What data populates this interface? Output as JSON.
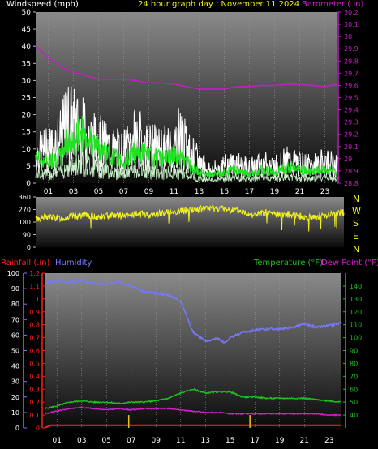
{
  "header": {
    "left_label": "Windspeed (mph)",
    "center_label": "24 hour graph day : November 11 2024",
    "right_label": "Barometer (.in)"
  },
  "colors": {
    "background": "#000000",
    "plot_top": "#8a8a8a",
    "plot_bottom": "#0a0a0a",
    "wind_gust": "#ffffff",
    "wind_avg": "#22e022",
    "wind_min": "#c8f0c8",
    "barometer": "#c020c0",
    "direction": "#f0f020",
    "rainfall": "#ff2020",
    "humidity": "#7878ff",
    "temperature": "#20c020",
    "dewpoint": "#d020d0",
    "hours": "#ffffff",
    "left_axis_text": "#ffffff",
    "direction_letters": "#f0f020",
    "rain_bar": "#f0c020"
  },
  "time_axis_labels": [
    "01",
    "03",
    "05",
    "07",
    "09",
    "11",
    "13",
    "15",
    "17",
    "19",
    "21",
    "23"
  ],
  "panel_labels": {
    "compass": [
      "N",
      "W",
      "S",
      "E",
      "N"
    ],
    "rainfall": "Rainfall (.in)",
    "humidity": "Humidity",
    "temperature": "Temperature (°F)",
    "dewpoint": "Dew Point (°F)"
  },
  "chart_data": [
    {
      "type": "line",
      "title": "24 hour graph day : November 11 2024",
      "x_range": [
        0,
        24
      ],
      "y_left": {
        "label": "Windspeed (mph)",
        "range": [
          0,
          50
        ],
        "ticks": [
          0,
          5,
          10,
          15,
          20,
          25,
          30,
          35,
          40,
          45,
          50
        ]
      },
      "y_right": {
        "label": "Barometer (.in)",
        "range": [
          28.8,
          30.2
        ],
        "ticks": [
          "28.8",
          "28.9",
          "29",
          "29.1",
          "29.2",
          "29.3",
          "29.4",
          "29.5",
          "29.6",
          "29.7",
          "29.8",
          "29.9",
          "30",
          "30.1",
          "30.2"
        ]
      },
      "series": [
        {
          "name": "Windspeed (mph)",
          "points": [
            [
              0,
              9
            ],
            [
              1,
              8
            ],
            [
              2,
              10
            ],
            [
              2.5,
              16
            ],
            [
              3,
              14
            ],
            [
              3.5,
              19
            ],
            [
              4,
              17
            ],
            [
              4.5,
              15
            ],
            [
              5,
              13
            ],
            [
              6,
              10
            ],
            [
              7,
              8
            ],
            [
              8,
              12
            ],
            [
              9,
              10
            ],
            [
              10,
              9
            ],
            [
              11,
              10
            ],
            [
              12,
              8
            ],
            [
              13,
              4
            ],
            [
              14,
              3
            ],
            [
              15,
              4
            ],
            [
              16,
              5
            ],
            [
              17,
              3
            ],
            [
              18,
              5
            ],
            [
              19,
              4
            ],
            [
              20,
              6
            ],
            [
              21,
              5
            ],
            [
              22,
              4
            ],
            [
              23,
              5
            ],
            [
              24,
              4
            ]
          ]
        },
        {
          "name": "Wind Gust (mph)",
          "points": [
            [
              0,
              12
            ],
            [
              1,
              14
            ],
            [
              2,
              18
            ],
            [
              2.5,
              26
            ],
            [
              3,
              24
            ],
            [
              3.5,
              22
            ],
            [
              4,
              20
            ],
            [
              4.5,
              18
            ],
            [
              5,
              17
            ],
            [
              6,
              14
            ],
            [
              7,
              13
            ],
            [
              8,
              19
            ],
            [
              9,
              15
            ],
            [
              10,
              14
            ],
            [
              11,
              15
            ],
            [
              11.5,
              21
            ],
            [
              12,
              14
            ],
            [
              13,
              9
            ],
            [
              14,
              5
            ],
            [
              15,
              7
            ],
            [
              16,
              8
            ],
            [
              17,
              6
            ],
            [
              18,
              8
            ],
            [
              19,
              7
            ],
            [
              20,
              9
            ],
            [
              21,
              8
            ],
            [
              22,
              7
            ],
            [
              23,
              9
            ],
            [
              24,
              7
            ]
          ]
        },
        {
          "name": "Barometer (.in)",
          "axis": "right",
          "points": [
            [
              0,
              29.92
            ],
            [
              1,
              29.83
            ],
            [
              2,
              29.75
            ],
            [
              3,
              29.71
            ],
            [
              4,
              29.68
            ],
            [
              5,
              29.65
            ],
            [
              6,
              29.65
            ],
            [
              7,
              29.65
            ],
            [
              8,
              29.64
            ],
            [
              9,
              29.62
            ],
            [
              10,
              29.62
            ],
            [
              11,
              29.61
            ],
            [
              12,
              29.59
            ],
            [
              13,
              29.57
            ],
            [
              14,
              29.57
            ],
            [
              15,
              29.57
            ],
            [
              16,
              29.59
            ],
            [
              17,
              29.59
            ],
            [
              18,
              29.6
            ],
            [
              19,
              29.6
            ],
            [
              20,
              29.61
            ],
            [
              21,
              29.61
            ],
            [
              22,
              29.6
            ],
            [
              23,
              29.59
            ],
            [
              24,
              29.61
            ]
          ]
        }
      ]
    },
    {
      "type": "line",
      "y_left": {
        "range": [
          0,
          360
        ],
        "ticks": [
          0,
          90,
          180,
          270,
          360
        ]
      },
      "series": [
        {
          "name": "Wind Direction",
          "points": [
            [
              0,
              200
            ],
            [
              1,
              218
            ],
            [
              2,
              205
            ],
            [
              3,
              222
            ],
            [
              4,
              230
            ],
            [
              5,
              215
            ],
            [
              6,
              235
            ],
            [
              7,
              222
            ],
            [
              8,
              240
            ],
            [
              9,
              230
            ],
            [
              10,
              250
            ],
            [
              11,
              255
            ],
            [
              12,
              268
            ],
            [
              13,
              275
            ],
            [
              14,
              280
            ],
            [
              15,
              272
            ],
            [
              16,
              258
            ],
            [
              17,
              230
            ],
            [
              18,
              248
            ],
            [
              19,
              232
            ],
            [
              20,
              238
            ],
            [
              21,
              212
            ],
            [
              22,
              218
            ],
            [
              23,
              238
            ],
            [
              24,
              248
            ]
          ]
        }
      ]
    },
    {
      "type": "line",
      "x_range": [
        0,
        24
      ],
      "y_left_outer": {
        "label": "Humidity",
        "range": [
          0,
          100
        ],
        "ticks": [
          0,
          10,
          20,
          30,
          40,
          50,
          60,
          70,
          80,
          90,
          100
        ]
      },
      "y_left_inner": {
        "label": "Rainfall (.in)",
        "range": [
          0,
          1.2
        ],
        "ticks": [
          "0",
          "0.1",
          "0.2",
          "0.3",
          "0.4",
          "0.5",
          "0.6",
          "0.7",
          "0.8",
          "0.9",
          "1",
          "1.1",
          "1.2"
        ]
      },
      "y_right": {
        "label": "Temperature (°F)",
        "range": [
          30,
          150
        ],
        "ticks": [
          40,
          50,
          60,
          70,
          80,
          90,
          100,
          110,
          120,
          130,
          140
        ]
      },
      "series": [
        {
          "name": "Humidity",
          "points": [
            [
              0,
              93
            ],
            [
              1,
              95
            ],
            [
              2,
              94
            ],
            [
              3,
              95
            ],
            [
              4,
              93
            ],
            [
              5,
              93
            ],
            [
              6,
              94
            ],
            [
              7,
              92
            ],
            [
              8,
              88
            ],
            [
              9,
              87
            ],
            [
              10,
              86
            ],
            [
              11,
              82
            ],
            [
              11.5,
              72
            ],
            [
              12,
              62
            ],
            [
              13,
              56
            ],
            [
              14,
              58
            ],
            [
              14.5,
              55
            ],
            [
              15,
              58
            ],
            [
              16,
              62
            ],
            [
              17,
              63
            ],
            [
              18,
              64
            ],
            [
              19,
              64
            ],
            [
              20,
              65
            ],
            [
              21,
              67
            ],
            [
              22,
              65
            ],
            [
              23,
              66
            ],
            [
              24,
              68
            ]
          ]
        },
        {
          "name": "Temperature (°F)",
          "axis": "right",
          "points": [
            [
              0,
              45
            ],
            [
              1,
              47
            ],
            [
              2,
              50
            ],
            [
              3,
              51
            ],
            [
              4,
              50
            ],
            [
              5,
              50
            ],
            [
              6,
              49
            ],
            [
              7,
              50
            ],
            [
              8,
              50
            ],
            [
              9,
              51
            ],
            [
              10,
              53
            ],
            [
              11,
              57
            ],
            [
              12,
              60
            ],
            [
              13,
              57
            ],
            [
              14,
              58
            ],
            [
              15,
              58
            ],
            [
              16,
              54
            ],
            [
              17,
              54
            ],
            [
              18,
              53
            ],
            [
              19,
              53
            ],
            [
              20,
              53
            ],
            [
              21,
              53
            ],
            [
              22,
              52
            ],
            [
              23,
              51
            ],
            [
              24,
              50
            ]
          ]
        },
        {
          "name": "Dew Point (°F)",
          "axis": "right",
          "points": [
            [
              0,
              41
            ],
            [
              1,
              43
            ],
            [
              2,
              45
            ],
            [
              3,
              46
            ],
            [
              4,
              45
            ],
            [
              5,
              44
            ],
            [
              6,
              45
            ],
            [
              7,
              44
            ],
            [
              8,
              45
            ],
            [
              9,
              45
            ],
            [
              10,
              45
            ],
            [
              11,
              44
            ],
            [
              12,
              43
            ],
            [
              13,
              42
            ],
            [
              14,
              42
            ],
            [
              15,
              41
            ],
            [
              16,
              41
            ],
            [
              17,
              41
            ],
            [
              18,
              41
            ],
            [
              19,
              41
            ],
            [
              20,
              41
            ],
            [
              21,
              41
            ],
            [
              22,
              41
            ],
            [
              23,
              40
            ],
            [
              24,
              40
            ]
          ]
        },
        {
          "name": "Rainfall (.in)",
          "points": [
            [
              0,
              0
            ],
            [
              0.5,
              0.02
            ],
            [
              2,
              0.02
            ],
            [
              4,
              0.02
            ],
            [
              6.5,
              0.02
            ],
            [
              7,
              0.02
            ],
            [
              10,
              0.02
            ],
            [
              14,
              0.02
            ],
            [
              16.5,
              0.02
            ],
            [
              20,
              0.02
            ],
            [
              24,
              0.02
            ]
          ]
        }
      ],
      "rain_events": [
        [
          6.8,
          0.1
        ],
        [
          16.6,
          0.1
        ]
      ]
    }
  ]
}
